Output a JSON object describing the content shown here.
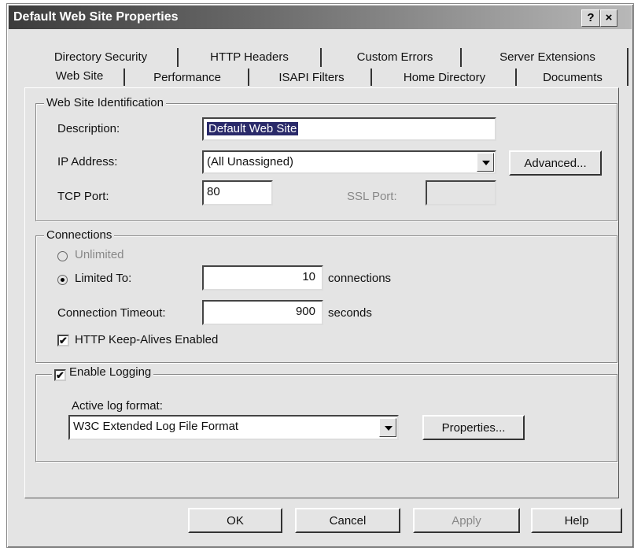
{
  "window": {
    "title": "Default Web Site Properties",
    "help_btn": "?",
    "close_btn": "×"
  },
  "tabs": {
    "row1": [
      "Directory Security",
      "HTTP Headers",
      "Custom Errors",
      "Server Extensions"
    ],
    "row2": [
      "Web Site",
      "Performance",
      "ISAPI Filters",
      "Home Directory",
      "Documents"
    ],
    "active": "Web Site"
  },
  "identification": {
    "legend": "Web Site Identification",
    "description_label": "Description:",
    "description_value": "Default Web Site",
    "ip_label": "IP Address:",
    "ip_value": "(All Unassigned)",
    "advanced_btn": "Advanced...",
    "tcp_label": "TCP Port:",
    "tcp_value": "80",
    "ssl_label": "SSL Port:",
    "ssl_value": ""
  },
  "connections": {
    "legend": "Connections",
    "unlimited_label": "Unlimited",
    "limited_label": "Limited To:",
    "limited_value": "10",
    "limited_unit": "connections",
    "timeout_label": "Connection Timeout:",
    "timeout_value": "900",
    "timeout_unit": "seconds",
    "keepalive_label": "HTTP Keep-Alives Enabled",
    "keepalive_checked": true,
    "selected": "limited"
  },
  "logging": {
    "legend": "Enable Logging",
    "enabled": true,
    "format_label": "Active log format:",
    "format_value": "W3C Extended Log File Format",
    "properties_btn": "Properties..."
  },
  "footer": {
    "ok": "OK",
    "cancel": "Cancel",
    "apply": "Apply",
    "help": "Help"
  },
  "check_mark": "✔"
}
